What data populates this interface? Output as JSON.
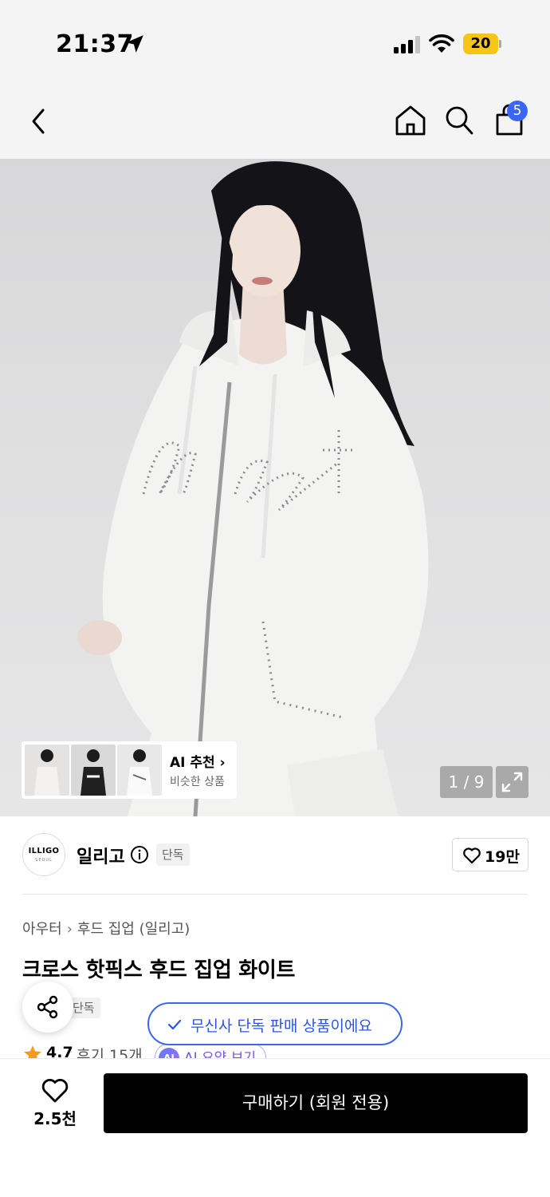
{
  "status_bar": {
    "time": "21:37",
    "battery": "20"
  },
  "navbar": {
    "cart_count": "5"
  },
  "gallery": {
    "ai_recommend_title": "AI 추천 ›",
    "ai_recommend_subtitle": "비슷한 상품",
    "pager": "1 / 9"
  },
  "brand": {
    "logo_text": "ILLIGO",
    "logo_subtext": "SEOUL",
    "name": "일리고",
    "exclusive_tag": "단독",
    "like_count": "19만"
  },
  "product": {
    "breadcrumb": [
      "아우터",
      "후드 집업 (일리고)"
    ],
    "title": "크로스 핫픽스 후드 집업 화이트",
    "exclusive_tag": "단독",
    "toast": "무신사 단독 판매 상품이에요",
    "rating": "4.7",
    "review_label": "후기 15개",
    "ai_summary_badge": "AI",
    "ai_summary_label": "AI 요약 보기"
  },
  "bottom_bar": {
    "wish_count": "2.5천",
    "buy_label": "구매하기 (회원 전용)"
  },
  "colors": {
    "accent_blue": "#3b66f5",
    "battery_yellow": "#f5c518",
    "buy_button": "#000000",
    "toast_text": "#2a54e6"
  }
}
